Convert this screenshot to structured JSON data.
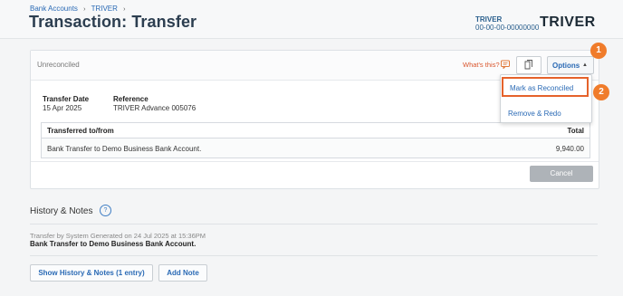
{
  "header": {
    "breadcrumb": [
      "Bank Accounts",
      "TRIVER"
    ],
    "breadcrumb_sep": "›",
    "title": "Transaction: Transfer",
    "org_name": "TRIVER",
    "org_number": "00-00-00-00000000",
    "logo_text": "TRIVER"
  },
  "transaction": {
    "status": "Unreconciled",
    "whats_this": "What's this?",
    "options_label": "Options",
    "options_caret": "▲",
    "transfer_date_label": "Transfer Date",
    "transfer_date_value": "15 Apr 2025",
    "reference_label": "Reference",
    "reference_value": "TRIVER Advance 005076",
    "table": {
      "col_left": "Transferred to/from",
      "col_right": "Total",
      "rows": [
        {
          "description": "Bank Transfer to Demo Business Bank Account.",
          "total": "9,940.00"
        }
      ]
    },
    "cancel_label": "Cancel"
  },
  "options_menu": {
    "items": [
      "Mark as Reconciled",
      "Remove & Redo"
    ]
  },
  "markers": [
    "1",
    "2"
  ],
  "history": {
    "title": "History & Notes",
    "help_glyph": "?",
    "entry_meta": "Transfer by System Generated on 24 Jul 2025 at 15:36PM",
    "entry_desc": "Bank Transfer to Demo Business Bank Account.",
    "show_button": "Show History & Notes (1 entry)",
    "add_note_button": "Add Note"
  },
  "colors": {
    "accent_blue": "#2a6ab5",
    "marker_orange": "#f07c2b",
    "highlight_border": "#e5622b",
    "cancel_gray": "#aeb3b8"
  },
  "icons": [
    "copy-icon",
    "whats-this-icon",
    "help-icon",
    "caret-up-icon"
  ]
}
